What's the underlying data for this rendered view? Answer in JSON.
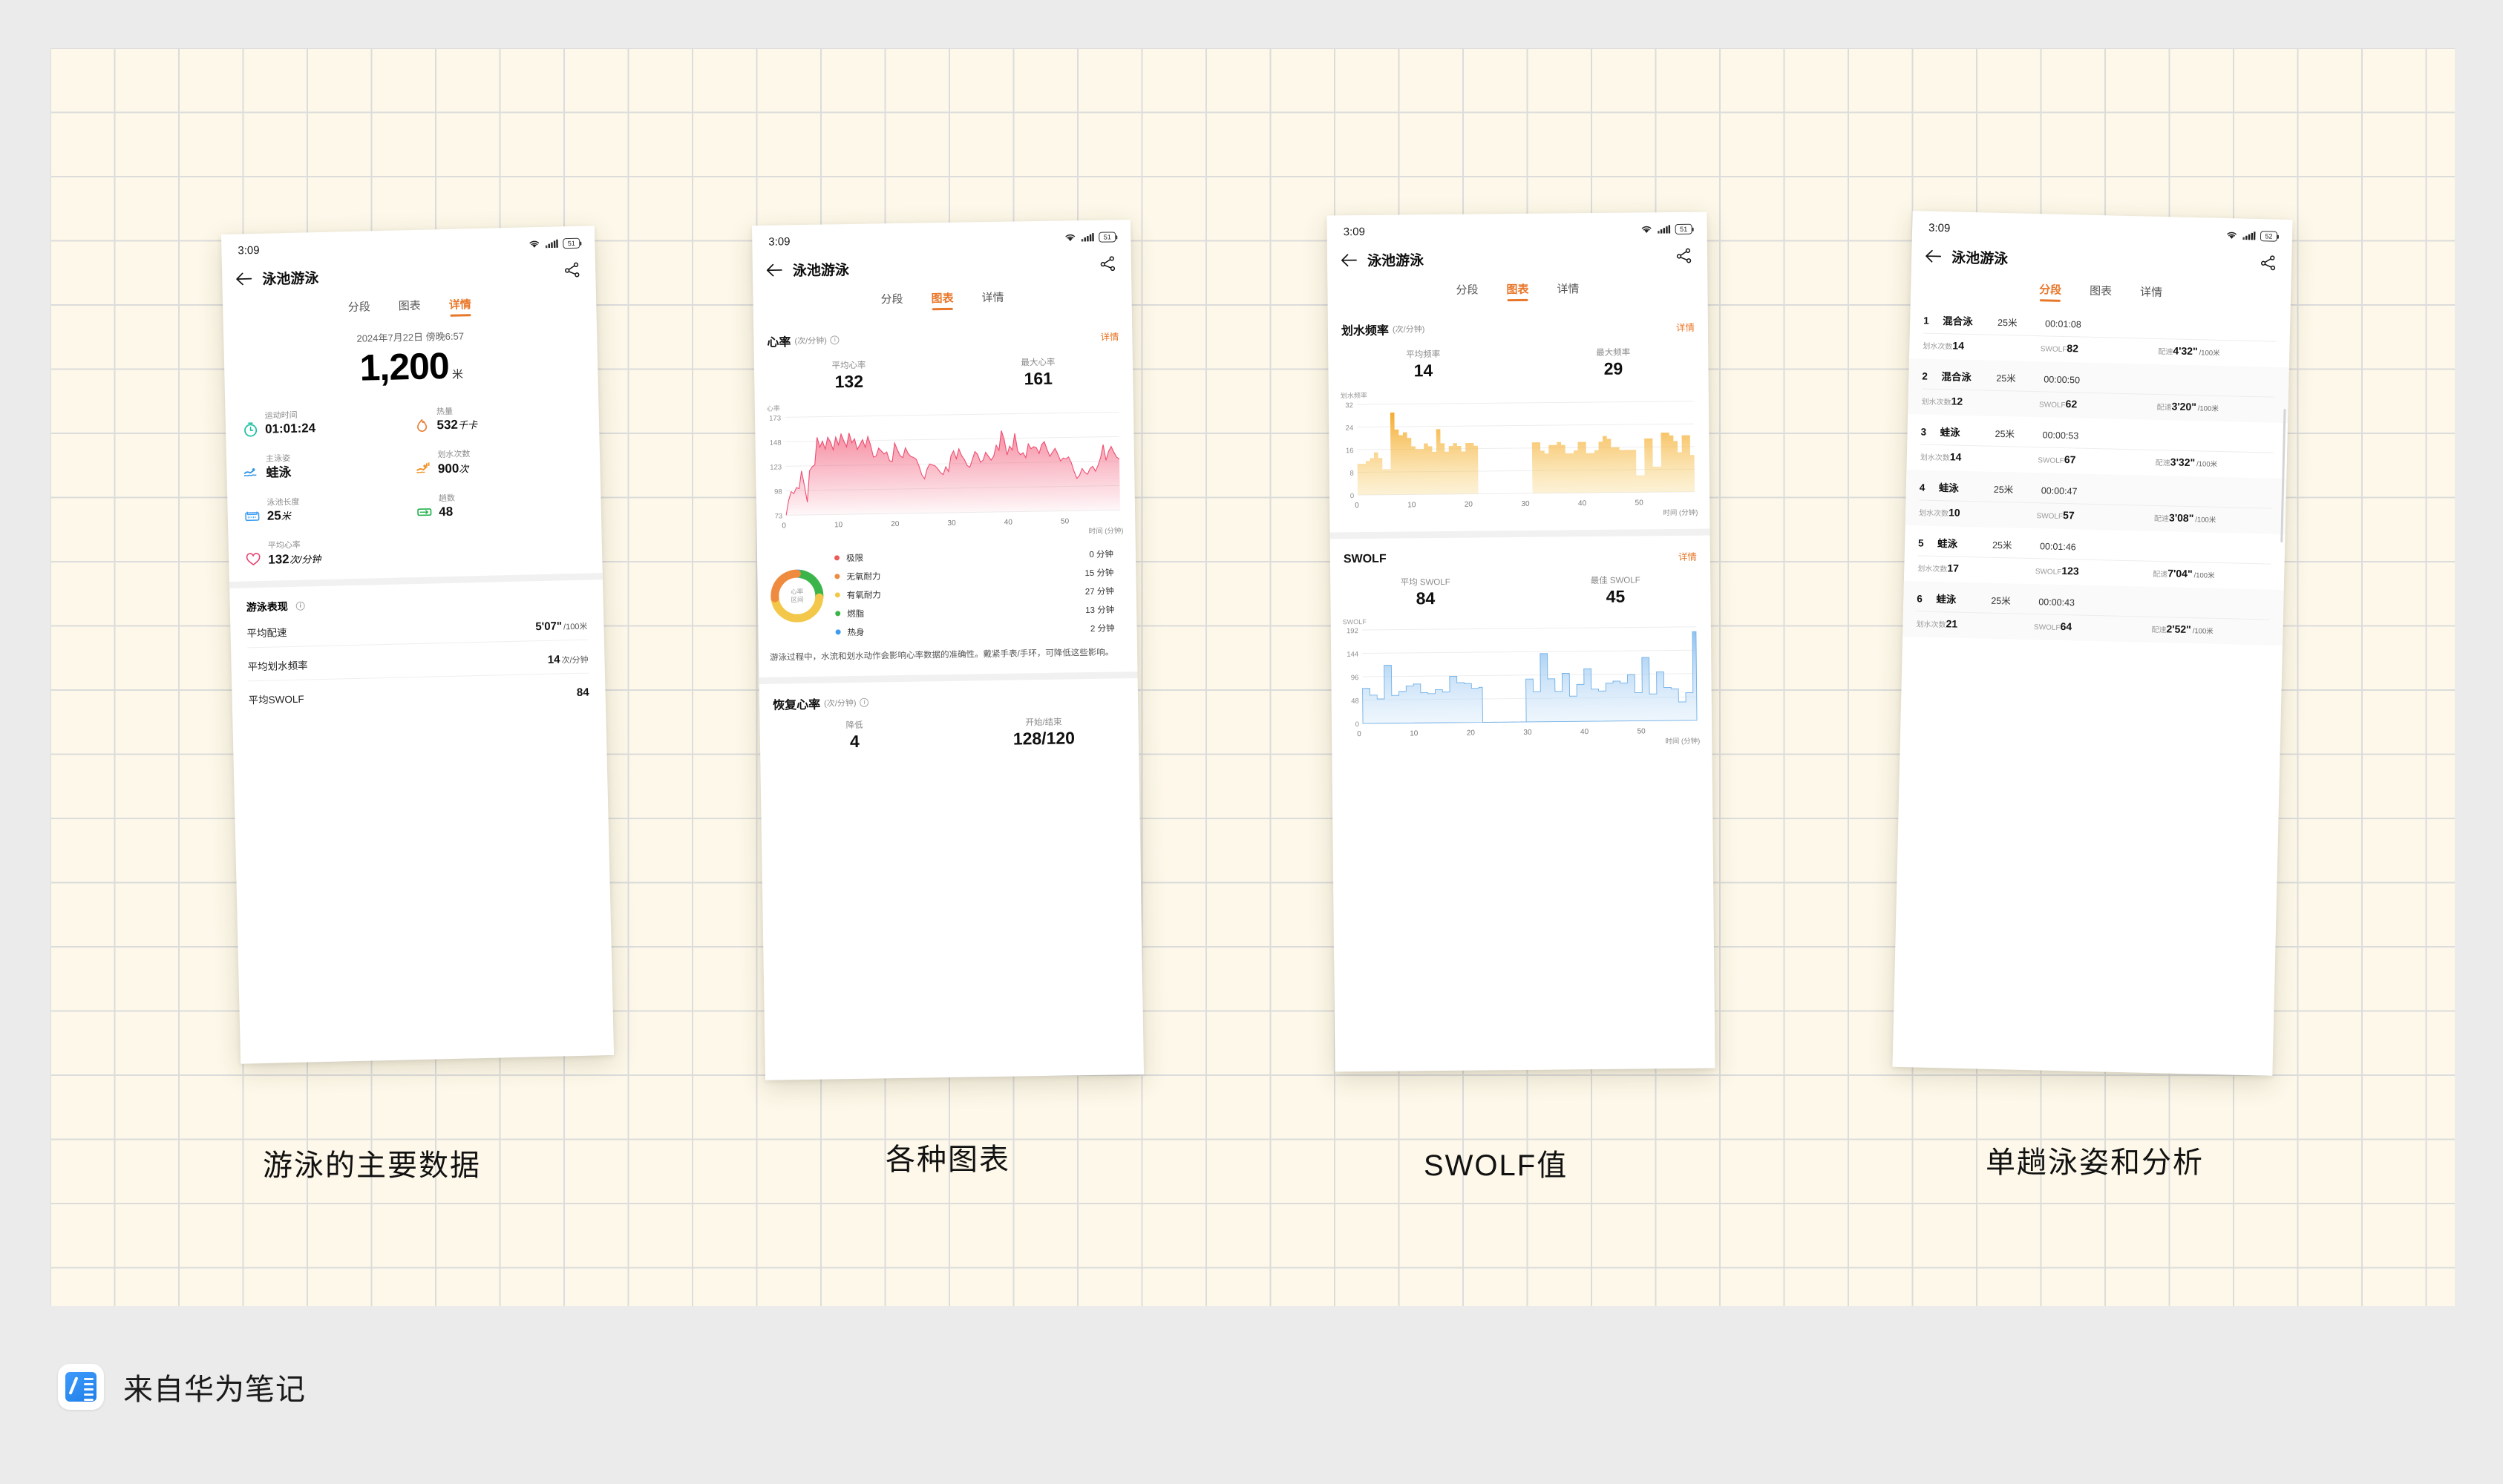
{
  "footer": {
    "label": "来自华为笔记",
    "icon": "note-app-icon"
  },
  "captions": [
    "游泳的主要数据",
    "各种图表",
    "SWOLF值",
    "单趟泳姿和分析"
  ],
  "colors": {
    "accent": "#e8772a",
    "paper": "#fdf8e9",
    "grid_line": "#dcdcdc",
    "page_bg": "#ebebeb",
    "hr_line": "#f26d8a",
    "stroke_fill": "#f5b731",
    "swolf_fill": "#8dc0ef"
  },
  "screen1": {
    "status": {
      "time": "3:09",
      "battery": "51",
      "wifi": "wifi-icon",
      "signal": "signal-icon"
    },
    "nav": {
      "back": "back-arrow-icon",
      "title": "泳池游泳",
      "share": "share-icon"
    },
    "tabs": [
      {
        "label": "分段",
        "active": false
      },
      {
        "label": "图表",
        "active": false
      },
      {
        "label": "详情",
        "active": true
      }
    ],
    "date": "2024年7月22日 傍晚6:57",
    "distance_value": "1,200",
    "distance_unit": "米",
    "metrics": [
      {
        "icon": "stopwatch-icon",
        "label": "运动时间",
        "value": "01:01:24",
        "unit": ""
      },
      {
        "icon": "flame-icon",
        "label": "热量",
        "value": "532",
        "unit": "千卡"
      },
      {
        "icon": "swimmer-icon",
        "label": "主泳姿",
        "value": "蛙泳",
        "unit": ""
      },
      {
        "icon": "stroke-icon",
        "label": "划水次数",
        "value": "900",
        "unit": "次"
      },
      {
        "icon": "pool-icon",
        "label": "泳池长度",
        "value": "25",
        "unit": "米"
      },
      {
        "icon": "laps-icon",
        "label": "趟数",
        "value": "48",
        "unit": ""
      },
      {
        "icon": "heart-icon",
        "label": "平均心率",
        "value": "132",
        "unit": "次/分钟"
      }
    ],
    "performance": {
      "title": "游泳表现",
      "rows": [
        {
          "key": "平均配速",
          "value": "5'07\"",
          "unit": "/100米"
        },
        {
          "key": "平均划水频率",
          "value": "14",
          "unit": "次/分钟"
        },
        {
          "key": "平均SWOLF",
          "value": "84",
          "unit": ""
        }
      ]
    }
  },
  "screen2": {
    "status": {
      "time": "3:09",
      "battery": "51"
    },
    "nav": {
      "title": "泳池游泳"
    },
    "tabs": [
      {
        "label": "分段",
        "active": false
      },
      {
        "label": "图表",
        "active": true
      },
      {
        "label": "详情",
        "active": false
      }
    ],
    "hr_section": {
      "title": "心率",
      "unit": "(次/分钟)",
      "more": "详情",
      "stats": [
        {
          "label": "平均心率",
          "value": "132"
        },
        {
          "label": "最大心率",
          "value": "161"
        }
      ]
    },
    "zones": {
      "center_line1": "心率",
      "center_line2": "区间",
      "rows": [
        {
          "name": "极限",
          "value": "0 分钟",
          "color": "#ec5a5a",
          "minutes": 0
        },
        {
          "name": "无氧耐力",
          "value": "15 分钟",
          "color": "#ef8b3f",
          "minutes": 15
        },
        {
          "name": "有氧耐力",
          "value": "27 分钟",
          "color": "#f3c84a",
          "minutes": 27
        },
        {
          "name": "燃脂",
          "value": "13 分钟",
          "color": "#3bb54a",
          "minutes": 13
        },
        {
          "name": "热身",
          "value": "2 分钟",
          "color": "#3c9cf0",
          "minutes": 2
        }
      ]
    },
    "tip": "游泳过程中，水流和划水动作会影响心率数据的准确性。戴紧手表/手环，可降低这些影响。",
    "recovery": {
      "title": "恢复心率",
      "unit": "(次/分钟)",
      "stats": [
        {
          "label": "降低",
          "value": "4"
        },
        {
          "label": "开始/结束",
          "value": "128/120"
        }
      ]
    }
  },
  "screen3": {
    "status": {
      "time": "3:09",
      "battery": "51"
    },
    "nav": {
      "title": "泳池游泳"
    },
    "tabs": [
      {
        "label": "分段",
        "active": false
      },
      {
        "label": "图表",
        "active": true
      },
      {
        "label": "详情",
        "active": false
      }
    ],
    "stroke_section": {
      "title": "划水频率",
      "unit": "(次/分钟)",
      "more": "详情",
      "stats": [
        {
          "label": "平均频率",
          "value": "14"
        },
        {
          "label": "最大频率",
          "value": "29"
        }
      ]
    },
    "swolf_section": {
      "title": "SWOLF",
      "more": "详情",
      "stats": [
        {
          "label": "平均 SWOLF",
          "value": "84"
        },
        {
          "label": "最佳 SWOLF",
          "value": "45"
        }
      ]
    }
  },
  "screen4": {
    "status": {
      "time": "3:09",
      "battery": "52"
    },
    "nav": {
      "title": "泳池游泳"
    },
    "tabs": [
      {
        "label": "分段",
        "active": true
      },
      {
        "label": "图表",
        "active": false
      },
      {
        "label": "详情",
        "active": false
      }
    ],
    "lap_headers": {
      "strokes": "划水次数",
      "swolf": "SWOLF",
      "pace": "配速"
    },
    "laps": [
      {
        "index": "1",
        "stroke": "混合泳",
        "distance": "25米",
        "duration": "00:01:08",
        "strokes": "14",
        "swolf": "82",
        "pace": "4'32\"",
        "pace_unit": "/100米"
      },
      {
        "index": "2",
        "stroke": "混合泳",
        "distance": "25米",
        "duration": "00:00:50",
        "strokes": "12",
        "swolf": "62",
        "pace": "3'20\"",
        "pace_unit": "/100米"
      },
      {
        "index": "3",
        "stroke": "蛙泳",
        "distance": "25米",
        "duration": "00:00:53",
        "strokes": "14",
        "swolf": "67",
        "pace": "3'32\"",
        "pace_unit": "/100米"
      },
      {
        "index": "4",
        "stroke": "蛙泳",
        "distance": "25米",
        "duration": "00:00:47",
        "strokes": "10",
        "swolf": "57",
        "pace": "3'08\"",
        "pace_unit": "/100米"
      },
      {
        "index": "5",
        "stroke": "蛙泳",
        "distance": "25米",
        "duration": "00:01:46",
        "strokes": "17",
        "swolf": "123",
        "pace": "7'04\"",
        "pace_unit": "/100米"
      },
      {
        "index": "6",
        "stroke": "蛙泳",
        "distance": "25米",
        "duration": "00:00:43",
        "strokes": "21",
        "swolf": "64",
        "pace": "2'52\"",
        "pace_unit": "/100米"
      }
    ]
  },
  "chart_data": [
    {
      "type": "area",
      "title": "心率",
      "ylabel": "心率",
      "xlabel": "时间 (分钟)",
      "yticks": [
        73,
        98,
        123,
        148,
        173
      ],
      "ylim": [
        73,
        173
      ],
      "xticks": [
        0,
        10,
        20,
        30,
        40,
        50
      ],
      "xlim": [
        0,
        59
      ],
      "grid": true,
      "legend": "none",
      "values": [
        73,
        88,
        97,
        95,
        101,
        100,
        118,
        103,
        86,
        118,
        122,
        124,
        152,
        142,
        148,
        140,
        152,
        147,
        139,
        152,
        144,
        155,
        148,
        142,
        156,
        146,
        150,
        139,
        144,
        149,
        141,
        152,
        143,
        131,
        132,
        140,
        137,
        134,
        136,
        127,
        126,
        145,
        138,
        132,
        130,
        140,
        134,
        131,
        130,
        128,
        121,
        112,
        108,
        118,
        123,
        122,
        121,
        118,
        114,
        112,
        120,
        115,
        131,
        136,
        128,
        138,
        131,
        127,
        121,
        119,
        127,
        135,
        132,
        124,
        126,
        134,
        130,
        126,
        130,
        141,
        136,
        156,
        147,
        131,
        140,
        136,
        153,
        135,
        131,
        133,
        128,
        142,
        137,
        139,
        138,
        132,
        141,
        144,
        136,
        129,
        133,
        137,
        131,
        124,
        127,
        126,
        128,
        122,
        113,
        106,
        109,
        116,
        112,
        110,
        116,
        118,
        113,
        119,
        127,
        140,
        124,
        133,
        138,
        132,
        127,
        125
      ]
    },
    {
      "type": "area",
      "title": "划水频率",
      "ylabel": "划水频率",
      "xlabel": "时间 (分钟)",
      "yticks": [
        0,
        8,
        16,
        24,
        32
      ],
      "ylim": [
        0,
        32
      ],
      "xticks": [
        0,
        10,
        20,
        30,
        40,
        50
      ],
      "xlim": [
        0,
        59
      ],
      "grid": true,
      "values": [
        11,
        11,
        12,
        13,
        15,
        13,
        9,
        9,
        29,
        23,
        21,
        22,
        20,
        17,
        16,
        16,
        18,
        17,
        15,
        23,
        18,
        15,
        17,
        18,
        17,
        15,
        18,
        18,
        17,
        0,
        0,
        0,
        0,
        0,
        0,
        0,
        0,
        0,
        0,
        0,
        0,
        0,
        18,
        18,
        15,
        14,
        17,
        17,
        18,
        17,
        14,
        14,
        15,
        18,
        18,
        14,
        14,
        15,
        18,
        20,
        19,
        16,
        16,
        15,
        15,
        15,
        15,
        6,
        6,
        19,
        19,
        9,
        9,
        21,
        21,
        20,
        18,
        14,
        20,
        20,
        13,
        13
      ]
    },
    {
      "type": "area",
      "title": "SWOLF",
      "ylabel": "SWOLF",
      "xlabel": "时间 (分钟)",
      "yticks": [
        0,
        48,
        96,
        144,
        192
      ],
      "ylim": [
        0,
        192
      ],
      "xticks": [
        0,
        10,
        20,
        30,
        40,
        50
      ],
      "xlim": [
        0,
        59
      ],
      "grid": true,
      "values": [
        72,
        72,
        58,
        58,
        50,
        50,
        119,
        119,
        57,
        57,
        65,
        65,
        76,
        76,
        80,
        80,
        62,
        62,
        60,
        60,
        68,
        68,
        63,
        63,
        95,
        95,
        82,
        82,
        80,
        80,
        70,
        70,
        72,
        0,
        0,
        0,
        0,
        0,
        0,
        0,
        0,
        0,
        0,
        0,
        0,
        88,
        88,
        62,
        62,
        140,
        140,
        88,
        88,
        62,
        62,
        99,
        99,
        52,
        52,
        76,
        76,
        108,
        108,
        66,
        66,
        62,
        62,
        78,
        78,
        82,
        82,
        78,
        78,
        95,
        95,
        58,
        58,
        130,
        130,
        55,
        55,
        100,
        100,
        68,
        68,
        65,
        65,
        38,
        38,
        57,
        57,
        182,
        182
      ]
    }
  ]
}
